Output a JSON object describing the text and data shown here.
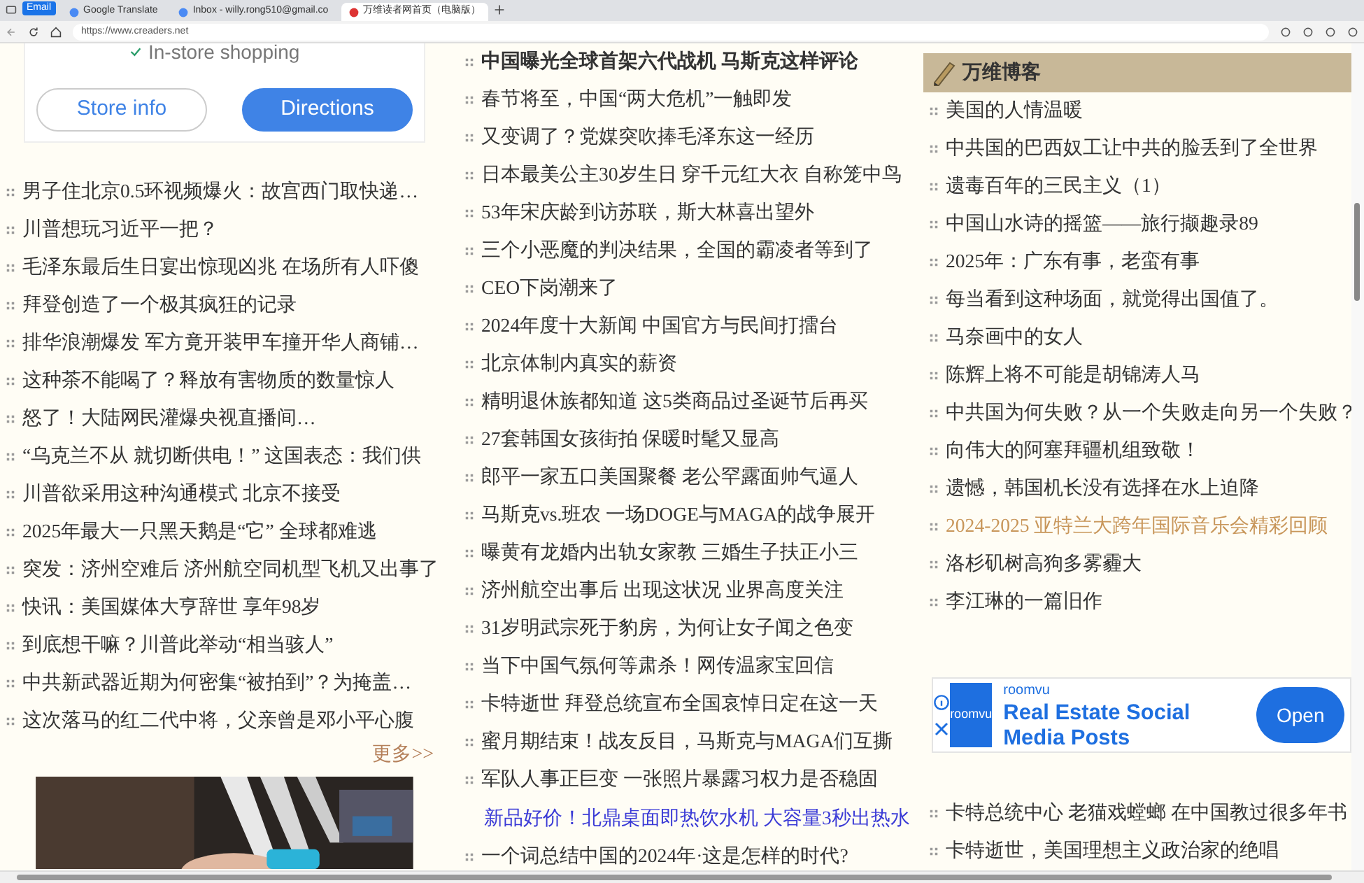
{
  "browser": {
    "tab_group": "Email",
    "tabs": [
      {
        "title": "Google Translate",
        "selected": false
      },
      {
        "title": "Inbox - willy.rong510@gmail.co",
        "selected": false
      },
      {
        "title": "万维读者网首页（电脑版）",
        "selected": true
      }
    ],
    "url": "https://www.creaders.net"
  },
  "store_card": {
    "feature": "In-store shopping",
    "buttons": [
      {
        "label": "Store info",
        "primary": false
      },
      {
        "label": "Directions",
        "primary": true
      }
    ]
  },
  "left_news": [
    {
      "title": "男子住北京0.5环视频爆火：故宫西门取快递…"
    },
    {
      "title": "川普想玩习近平一把？"
    },
    {
      "title": "毛泽东最后生日宴出惊现凶兆 在场所有人吓傻"
    },
    {
      "title": "拜登创造了一个极其疯狂的记录"
    },
    {
      "title": "排华浪潮爆发 军方竟开装甲车撞开华人商铺…"
    },
    {
      "title": "这种茶不能喝了？释放有害物质的数量惊人"
    },
    {
      "title": "怒了！大陆网民灌爆央视直播间…"
    },
    {
      "title": "“乌克兰不从 就切断供电！” 这国表态：我们供"
    },
    {
      "title": "川普欲采用这种沟通模式 北京不接受"
    },
    {
      "title": "2025年最大一只黑天鹅是“它” 全球都难逃"
    },
    {
      "title": "突发：济州空难后 济州航空同机型飞机又出事了"
    },
    {
      "title": "快讯：美国媒体大亨辞世 享年98岁"
    },
    {
      "title": "到底想干嘛？川普此举动“相当骇人”"
    },
    {
      "title": "中共新武器近期为何密集“被拍到”？为掩盖…"
    },
    {
      "title": "这次落马的红二代中将，父亲曾是邓小平心腹"
    }
  ],
  "left_more": "更多>>",
  "middle_news": [
    {
      "title": "中国曝光全球首架六代战机 马斯克这样评论",
      "bold": true
    },
    {
      "title": "春节将至，中国“两大危机”一触即发",
      "bold": false
    },
    {
      "title": "又变调了？党媒突吹捧毛泽东这一经历",
      "bold": false
    },
    {
      "title": "日本最美公主30岁生日 穿千元红大衣 自称笼中鸟",
      "bold": false
    },
    {
      "title": "53年宋庆龄到访苏联，斯大林喜出望外",
      "bold": false
    },
    {
      "title": "三个小恶魔的判决结果，全国的霸凌者等到了",
      "bold": false
    },
    {
      "title": "CEO下岗潮来了",
      "bold": false
    },
    {
      "title": "2024年度十大新闻 中国官方与民间打擂台",
      "bold": false
    },
    {
      "title": "北京体制内真实的薪资",
      "bold": false
    },
    {
      "title": "精明退休族都知道 这5类商品过圣诞节后再买",
      "bold": false
    },
    {
      "title": "27套韩国女孩街拍 保暖时髦又显高",
      "bold": false
    },
    {
      "title": "郎平一家五口美国聚餐 老公罕露面帅气逼人",
      "bold": false
    },
    {
      "title": "马斯克vs.班农 一场DOGE与MAGA的战争展开",
      "bold": false
    },
    {
      "title": "曝黄有龙婚内出轨女家教 三婚生子扶正小三",
      "bold": false
    },
    {
      "title": "济州航空出事后 出现这状况 业界高度关注",
      "bold": false
    },
    {
      "title": "31岁明武宗死于豹房，为何让女子闻之色变",
      "bold": false
    },
    {
      "title": "当下中国气氛何等肃杀！网传温家宝回信",
      "bold": false
    },
    {
      "title": "卡特逝世 拜登总统宣布全国哀悼日定在这一天",
      "bold": false
    },
    {
      "title": "蜜月期结束！战友反目，马斯克与MAGA们互撕",
      "bold": false
    },
    {
      "title": "军队人事正巨变 一张照片暴露习权力是否稳固",
      "bold": false
    }
  ],
  "middle_ad": "新品好价！北鼎桌面即热饮水机 大容量3秒出热水",
  "middle_more_news": [
    {
      "title": "一个词总结中国的2024年·这是怎样的时代?"
    }
  ],
  "blog": {
    "title": "万维博客",
    "items": [
      {
        "title": "美国的人情温暖",
        "highlighted": false
      },
      {
        "title": "中共国的巴西奴工让中共的脸丢到了全世界",
        "highlighted": false
      },
      {
        "title": "遗毒百年的三民主义（1）",
        "highlighted": false
      },
      {
        "title": "中国山水诗的摇篮——旅行撷趣录89",
        "highlighted": false
      },
      {
        "title": "2025年：广东有事，老蛮有事",
        "highlighted": false
      },
      {
        "title": "每当看到这种场面，就觉得出国值了。",
        "highlighted": false
      },
      {
        "title": "马奈画中的女人",
        "highlighted": false
      },
      {
        "title": "陈辉上将不可能是胡锦涛人马",
        "highlighted": false
      },
      {
        "title": "中共国为何失败？从一个失败走向另一个失败？",
        "highlighted": false
      },
      {
        "title": "向伟大的阿塞拜疆机组致敬！",
        "highlighted": false
      },
      {
        "title": "遗憾，韩国机长没有选择在水上迫降",
        "highlighted": false
      },
      {
        "title": "2024-2025 亚特兰大跨年国际音乐会精彩回顾",
        "highlighted": true
      },
      {
        "title": "洛杉矶树高狗多雾霾大",
        "highlighted": false
      },
      {
        "title": "李江琳的一篇旧作",
        "highlighted": false
      }
    ]
  },
  "ad": {
    "logo": "roomvu",
    "brand": "roomvu",
    "headline": "Real Estate Social Media Posts",
    "button": "Open"
  },
  "more_blog": [
    {
      "title": "卡特总统中心 老猫戏螳螂 在中国教过很多年书"
    },
    {
      "title": "卡特逝世，美国理想主义政治家的绝唱"
    }
  ]
}
